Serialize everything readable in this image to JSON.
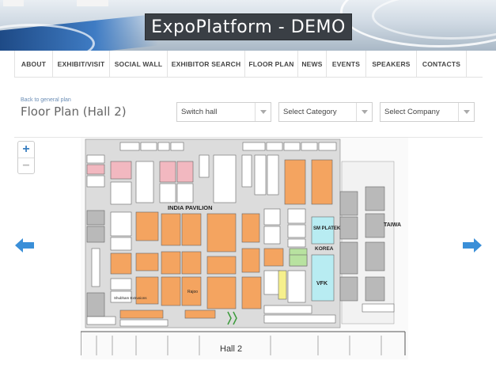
{
  "header": {
    "brand": "ExpoPlatform - DEMO"
  },
  "nav": {
    "items": [
      "ABOUT",
      "EXHIBIT/VISIT",
      "SOCIAL WALL",
      "EXHIBITOR SEARCH",
      "FLOOR PLAN",
      "NEWS",
      "EVENTS",
      "SPEAKERS",
      "CONTACTS"
    ]
  },
  "page": {
    "back_link": "Back to general plan",
    "title": "Floor Plan (Hall 2)"
  },
  "filters": {
    "hall": "Switch hall",
    "category": "Select Category",
    "company": "Select Company"
  },
  "map": {
    "zoom_in": "+",
    "zoom_out": "−",
    "pavilion_label": "INDIA PAVILION",
    "hall_label": "Hall 2",
    "korea_label": "KOREA",
    "taiwan_label": "TAIWA",
    "booths": {
      "sm_platek": "SM PLATEK",
      "vfk": "VFK",
      "shubham": "Shubham Extrusions",
      "rajoo": "Rajoo"
    }
  },
  "colors": {
    "booth_orange": "#f4a460",
    "booth_grey": "#b9b9b9",
    "booth_cyan": "#b8ecf2",
    "accent_blue": "#3a8fd8"
  }
}
